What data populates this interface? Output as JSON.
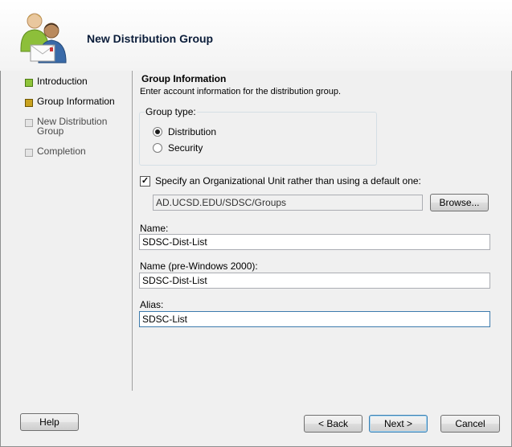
{
  "header": {
    "title": "New Distribution Group",
    "icon": "users-icon"
  },
  "steps": [
    {
      "label": "Introduction",
      "state": "done"
    },
    {
      "label": "Group Information",
      "state": "current"
    },
    {
      "label": "New Distribution Group",
      "state": "pending"
    },
    {
      "label": "Completion",
      "state": "pending"
    }
  ],
  "section": {
    "title": "Group Information",
    "description": "Enter account information for the distribution group."
  },
  "group_type": {
    "legend": "Group type:",
    "options": [
      {
        "label": "Distribution",
        "selected": true
      },
      {
        "label": "Security",
        "selected": false
      }
    ]
  },
  "ou": {
    "checkbox_label": "Specify an Organizational Unit rather than using a default one:",
    "checked": true,
    "path": "AD.UCSD.EDU/SDSC/Groups",
    "browse_label": "Browse..."
  },
  "fields": {
    "name_label": "Name:",
    "name_value": "SDSC-Dist-List",
    "pre2000_label": "Name (pre-Windows 2000):",
    "pre2000_value": "SDSC-Dist-List",
    "alias_label": "Alias:",
    "alias_value": "SDSC-List"
  },
  "buttons": {
    "help": "Help",
    "back": "< Back",
    "next": "Next >",
    "cancel": "Cancel"
  }
}
